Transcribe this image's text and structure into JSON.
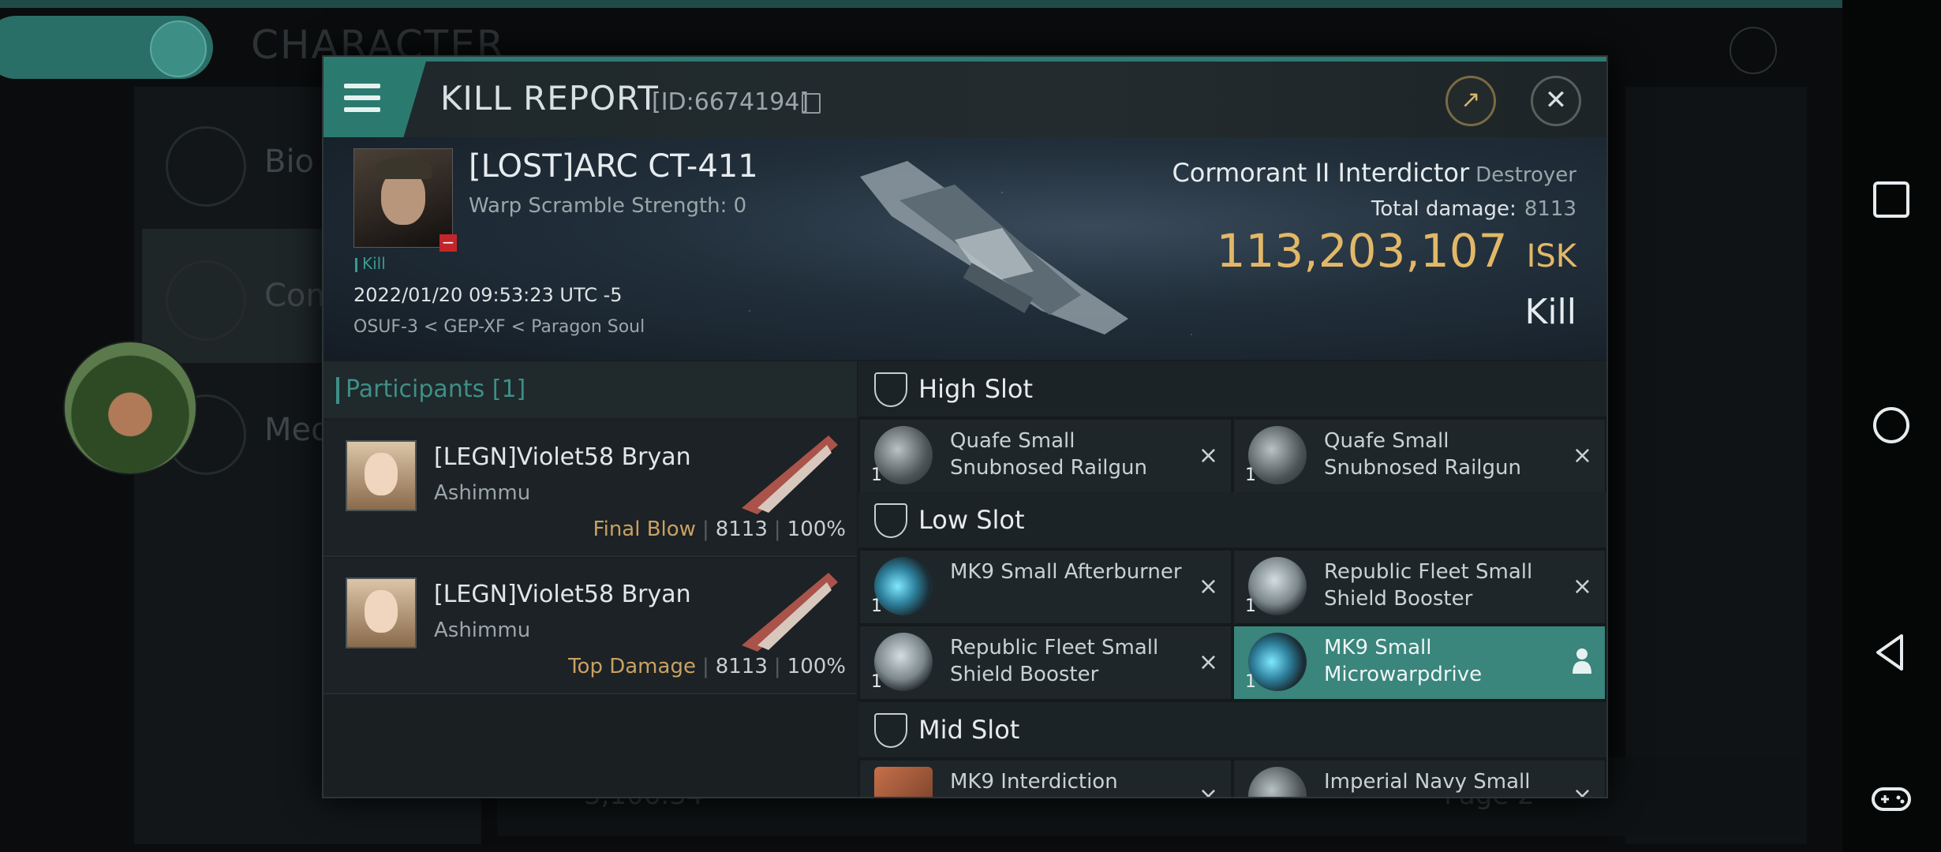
{
  "background": {
    "title": "CHARACTER",
    "menu_items": [
      "Bio",
      "Com",
      "Med"
    ],
    "bottom_value": "3,106.34",
    "page_label": "Page 2"
  },
  "modal": {
    "title": "KILL REPORT",
    "id_label": "[ID:6674194]",
    "victim": {
      "name": "[LOST]ARC CT-411",
      "warp_scramble": "Warp Scramble Strength: 0",
      "tag": "Kill",
      "datetime": "2022/01/20 09:53:23 UTC -5",
      "location": "OSUF-3 < GEP-XF < Paragon Soul"
    },
    "ship": {
      "name": "Cormorant II Interdictor",
      "class": "Destroyer",
      "total_damage_label": "Total damage:",
      "total_damage": "8113",
      "isk_value": "113,203,107",
      "isk_unit": "ISK",
      "result": "Kill"
    },
    "participants": {
      "header": "Participants [1]",
      "rows": [
        {
          "name": "[LEGN]Violet58 Bryan",
          "ship": "Ashimmu",
          "role": "Final Blow",
          "damage": "8113",
          "percent": "100%"
        },
        {
          "name": "[LEGN]Violet58 Bryan",
          "ship": "Ashimmu",
          "role": "Top Damage",
          "damage": "8113",
          "percent": "100%"
        }
      ]
    },
    "fitting": {
      "high_slot": "High Slot",
      "low_slot": "Low Slot",
      "mid_slot": "Mid Slot",
      "items": {
        "h1": {
          "name": "Quafe Small Snubnosed Railgun",
          "qty": "1"
        },
        "h2": {
          "name": "Quafe Small Snubnosed Railgun",
          "qty": "1"
        },
        "l1": {
          "name": "MK9 Small Afterburner",
          "qty": "1"
        },
        "l2": {
          "name": "Republic Fleet Small Shield Booster",
          "qty": "1"
        },
        "l3": {
          "name": "Republic Fleet Small Shield Booster",
          "qty": "1"
        },
        "l4": {
          "name": "MK9 Small Microwarpdrive",
          "qty": "1"
        },
        "m1": {
          "name": "MK9 Interdiction",
          "qty": ""
        },
        "m2": {
          "name": "Imperial Navy Small",
          "qty": ""
        }
      },
      "remove_icon": "×"
    }
  },
  "colors": {
    "accent": "#2b7a70",
    "isk": "#e2b868",
    "role": "#c9a162",
    "selected": "#3a857c"
  }
}
